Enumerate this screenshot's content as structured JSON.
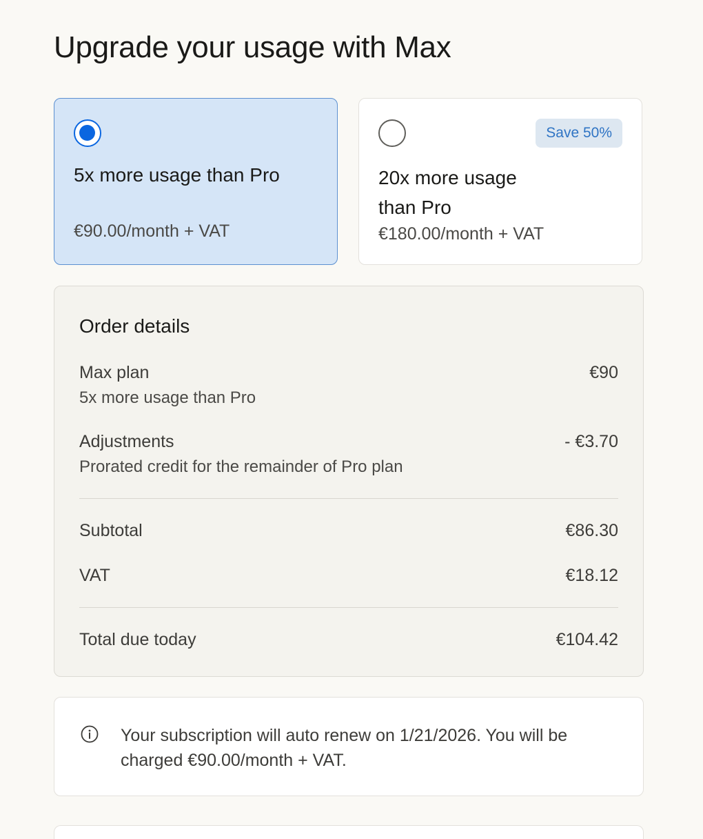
{
  "page": {
    "title": "Upgrade your usage with Max"
  },
  "plans": [
    {
      "name": "5x more usage than Pro",
      "price": "€90.00/month + VAT",
      "selected": true
    },
    {
      "name": "20x more usage than Pro",
      "price": "€180.00/month + VAT",
      "selected": false,
      "badge": "Save 50%"
    }
  ],
  "order": {
    "title": "Order details",
    "plan_label": "Max plan",
    "plan_description": "5x more usage than Pro",
    "plan_amount": "€90",
    "adjustments_label": "Adjustments",
    "adjustments_description": "Prorated credit for the remainder of Pro plan",
    "adjustments_amount": "- €3.70",
    "subtotal_label": "Subtotal",
    "subtotal_amount": "€86.30",
    "vat_label": "VAT",
    "vat_amount": "€18.12",
    "total_label": "Total due today",
    "total_amount": "€104.42"
  },
  "renewal_notice": {
    "icon": "info-icon",
    "text": "Your subscription will auto renew on 1/21/2026. You will be charged €90.00/month + VAT."
  },
  "colors": {
    "background": "#faf9f5",
    "selected_card": "#d5e5f7",
    "accent_blue": "#0a66e0",
    "badge_background": "#dde7f1",
    "badge_text": "#2f74c4"
  }
}
